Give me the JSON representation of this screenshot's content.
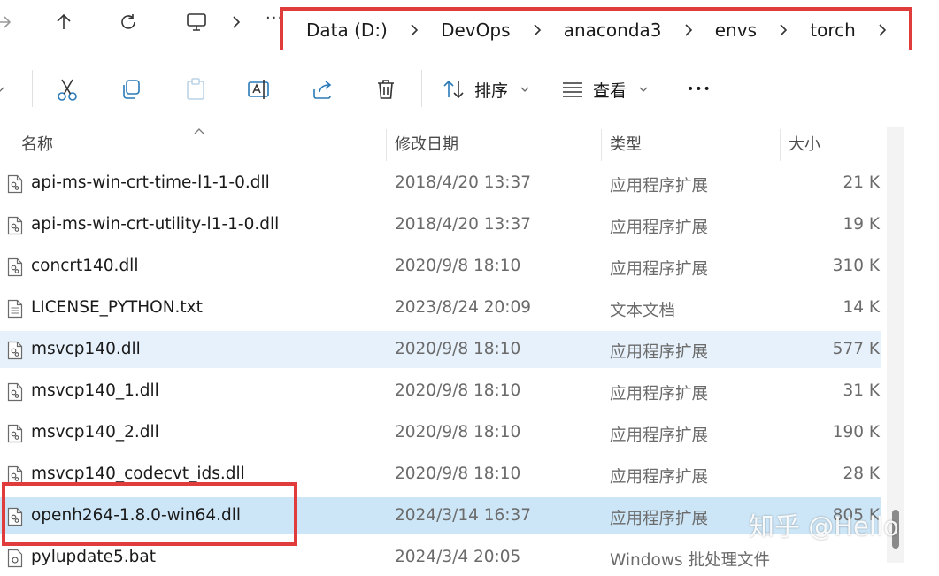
{
  "nav": {
    "pc_label": "···"
  },
  "breadcrumb": {
    "items": [
      "Data (D:)",
      "DevOps",
      "anaconda3",
      "envs",
      "torch"
    ]
  },
  "toolbar": {
    "sort_label": "排序",
    "view_label": "查看",
    "more_label": "•••"
  },
  "columns": {
    "name": "名称",
    "modified": "修改日期",
    "type": "类型",
    "size": "大小"
  },
  "files": [
    {
      "name": "api-ms-win-crt-time-l1-1-0.dll",
      "modified": "2018/4/20 13:37",
      "type": "应用程序扩展",
      "size": "21 K",
      "icon": "dll-file-icon"
    },
    {
      "name": "api-ms-win-crt-utility-l1-1-0.dll",
      "modified": "2018/4/20 13:37",
      "type": "应用程序扩展",
      "size": "19 K",
      "icon": "dll-file-icon"
    },
    {
      "name": "concrt140.dll",
      "modified": "2020/9/8 18:10",
      "type": "应用程序扩展",
      "size": "310 K",
      "icon": "dll-file-icon"
    },
    {
      "name": "LICENSE_PYTHON.txt",
      "modified": "2023/8/24 20:09",
      "type": "文本文档",
      "size": "14 K",
      "icon": "text-file-icon"
    },
    {
      "name": "msvcp140.dll",
      "modified": "2020/9/8 18:10",
      "type": "应用程序扩展",
      "size": "577 K",
      "icon": "dll-file-icon"
    },
    {
      "name": "msvcp140_1.dll",
      "modified": "2020/9/8 18:10",
      "type": "应用程序扩展",
      "size": "31 K",
      "icon": "dll-file-icon"
    },
    {
      "name": "msvcp140_2.dll",
      "modified": "2020/9/8 18:10",
      "type": "应用程序扩展",
      "size": "190 K",
      "icon": "dll-file-icon"
    },
    {
      "name": "msvcp140_codecvt_ids.dll",
      "modified": "2020/9/8 18:10",
      "type": "应用程序扩展",
      "size": "28 K",
      "icon": "dll-file-icon"
    },
    {
      "name": "openh264-1.8.0-win64.dll",
      "modified": "2024/3/14 16:37",
      "type": "应用程序扩展",
      "size": "805 K",
      "icon": "dll-file-icon"
    },
    {
      "name": "pylupdate5.bat",
      "modified": "2024/3/4 20:05",
      "type": "Windows 批处理文件",
      "size": "",
      "icon": "bat-file-icon"
    }
  ],
  "watermark": "知乎 @Hello",
  "colors": {
    "highlight_box": "#e03c3c",
    "hover_row": "#e6f1fb",
    "selected_row": "#cde6f7"
  }
}
